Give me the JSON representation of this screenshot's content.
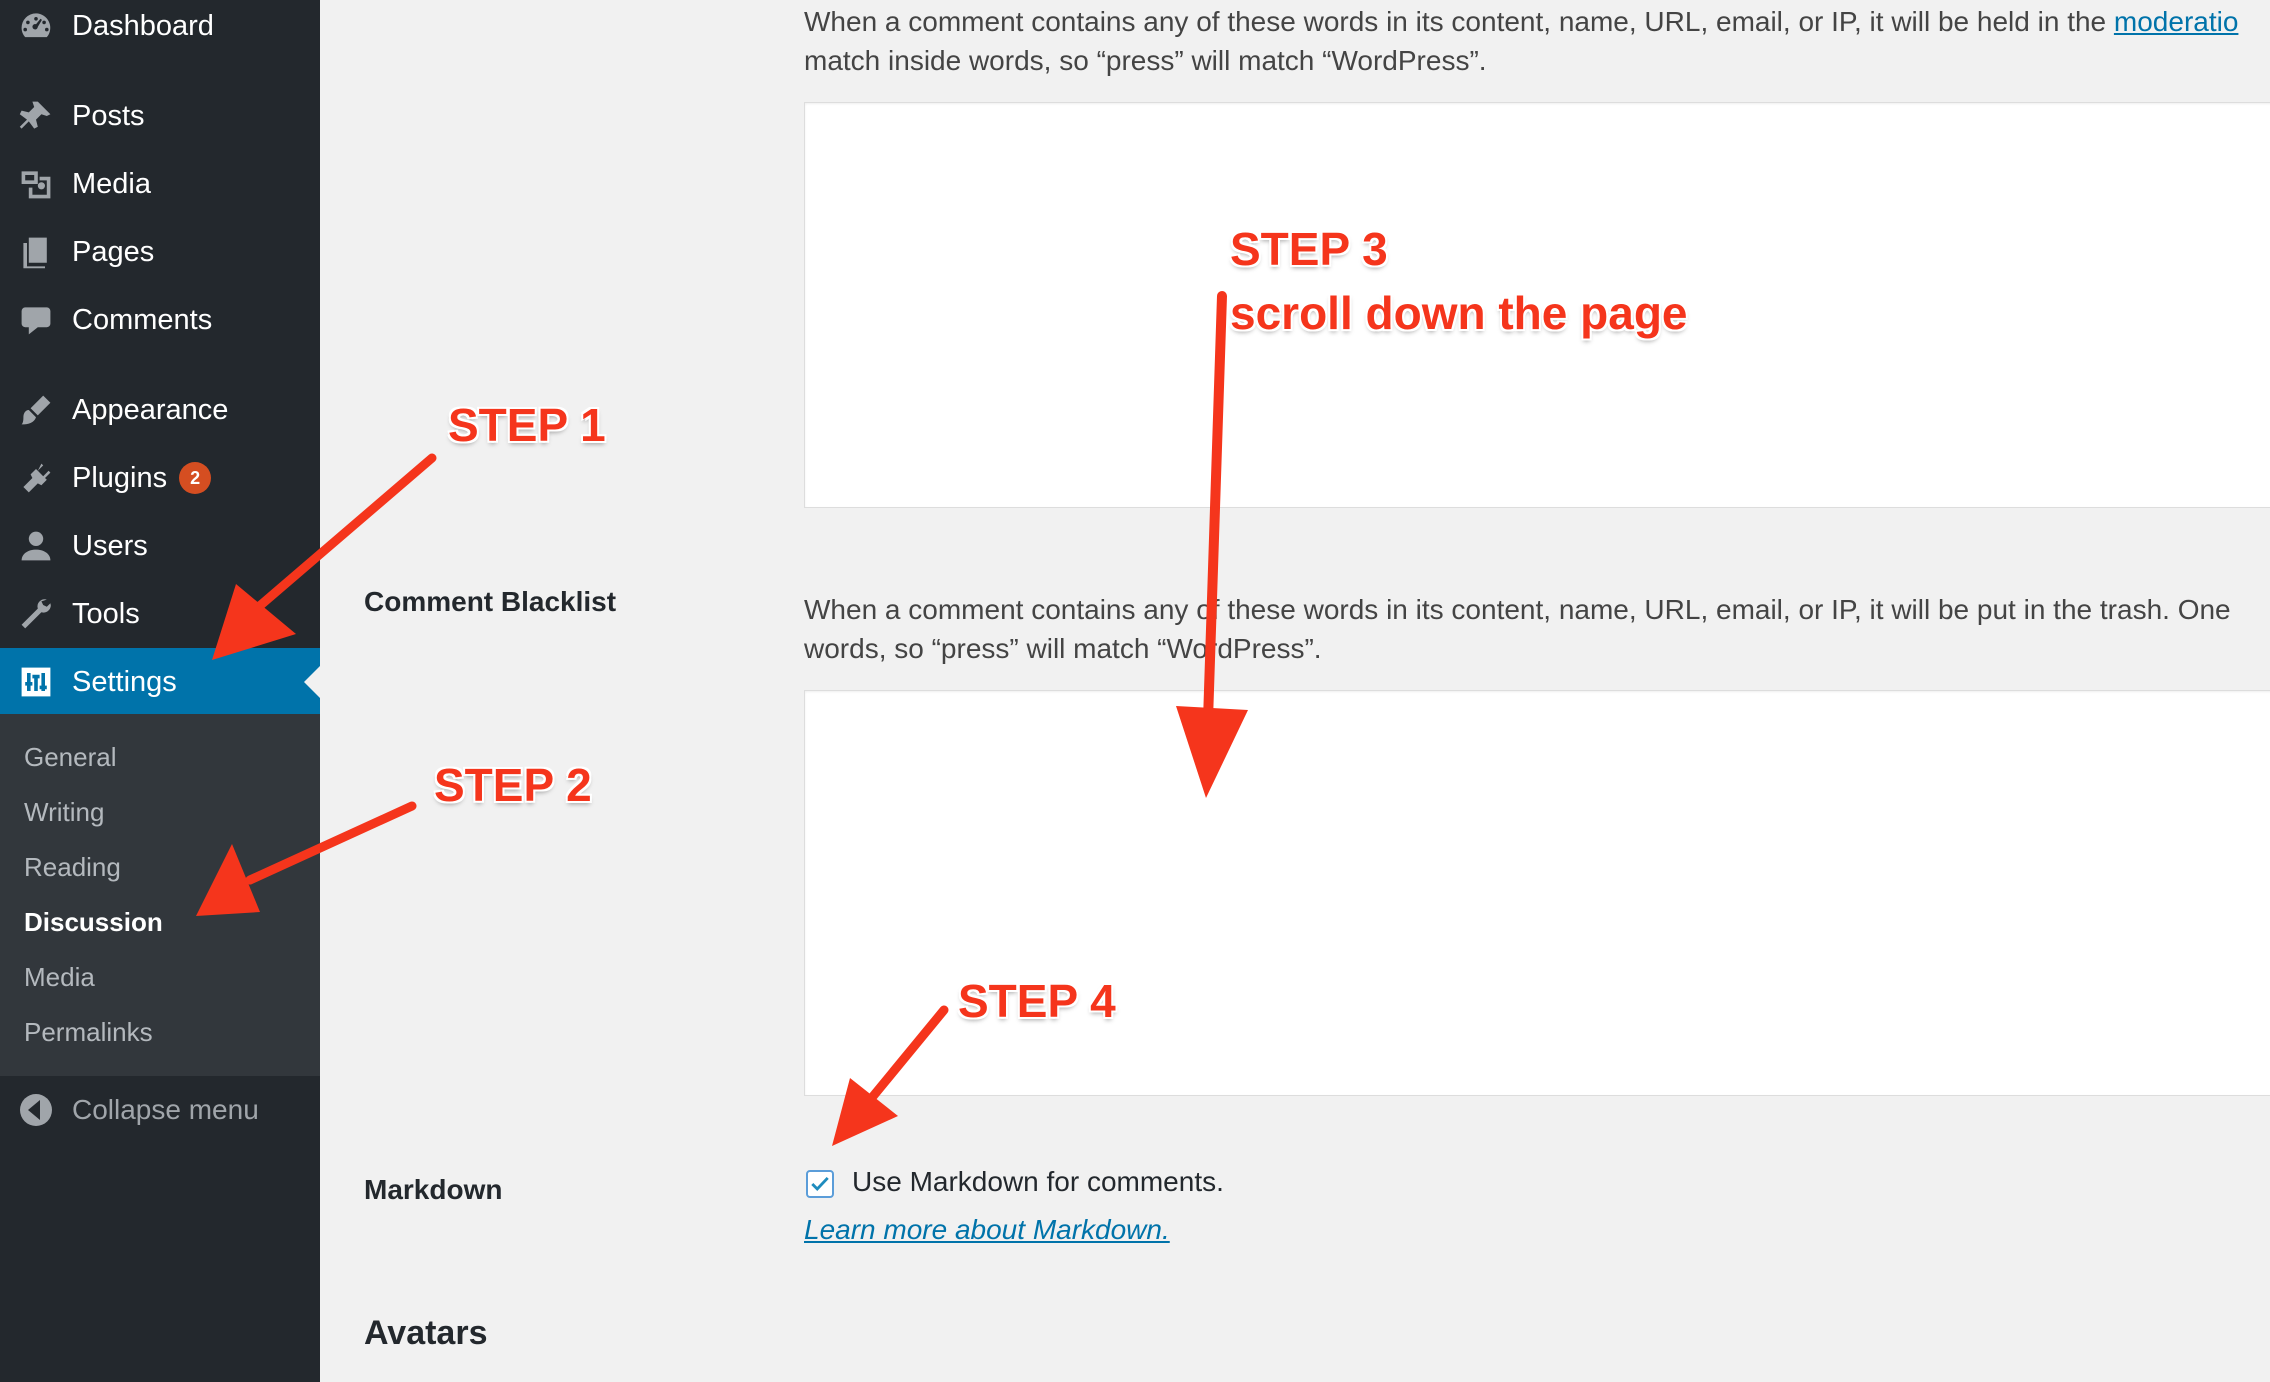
{
  "sidebar": {
    "items": [
      {
        "label": "Dashboard",
        "icon": "dashboard-icon"
      },
      {
        "label": "Posts",
        "icon": "pin-icon"
      },
      {
        "label": "Media",
        "icon": "media-icon"
      },
      {
        "label": "Pages",
        "icon": "pages-icon"
      },
      {
        "label": "Comments",
        "icon": "comment-icon"
      },
      {
        "label": "Appearance",
        "icon": "brush-icon"
      },
      {
        "label": "Plugins",
        "icon": "plugin-icon",
        "badge": "2"
      },
      {
        "label": "Users",
        "icon": "user-icon"
      },
      {
        "label": "Tools",
        "icon": "wrench-icon"
      },
      {
        "label": "Settings",
        "icon": "settings-icon",
        "current": true
      }
    ],
    "submenu": [
      "General",
      "Writing",
      "Reading",
      "Discussion",
      "Media",
      "Permalinks"
    ],
    "submenu_current": "Discussion",
    "collapse_label": "Collapse menu",
    "active_color": "#0073aa",
    "badge_color": "#d54e21"
  },
  "main": {
    "moderation": {
      "desc_line1_prefix": "When a comment contains any of these words in its content, name, URL, email, or IP, it will be held in the ",
      "desc_line1_link": "moderatio",
      "desc_line2": "match inside words, so “press” will match “WordPress”."
    },
    "blacklist": {
      "label": "Comment Blacklist",
      "desc_line1": "When a comment contains any of these words in its content, name, URL, email, or IP, it will be put in the trash. One",
      "desc_line2": "words, so “press” will match “WordPress”."
    },
    "markdown": {
      "label": "Markdown",
      "checkbox_label": "Use Markdown for comments.",
      "checked": true,
      "link": "Learn more about Markdown."
    },
    "avatars_heading": "Avatars"
  },
  "annotations": {
    "step1": "STEP 1",
    "step2": "STEP 2",
    "step3_line1": "STEP 3",
    "step3_line2": "scroll down the page",
    "step4": "STEP 4",
    "color": "#f5351c"
  }
}
